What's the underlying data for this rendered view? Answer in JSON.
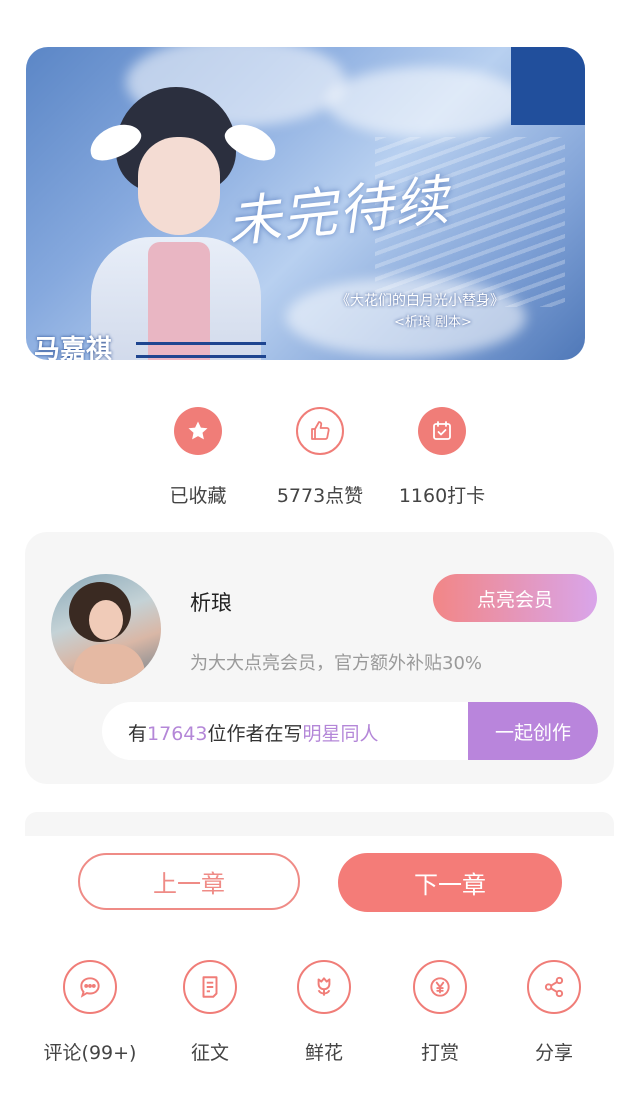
{
  "banner": {
    "title": "未完待续",
    "subtitle": "《大花们的白月光小替身》",
    "author_line": "<析琅 剧本>",
    "star_name": "马嘉祺"
  },
  "stats": [
    {
      "label": "已收藏",
      "icon": "star-icon"
    },
    {
      "label": "5773点赞",
      "icon": "thumbs-up-icon"
    },
    {
      "label": "1160打卡",
      "icon": "calendar-check-icon"
    }
  ],
  "author": {
    "name": "析琅",
    "vip_button": "点亮会员",
    "vip_desc": "为大大点亮会员，官方额外补贴30%"
  },
  "write_prompt": {
    "prefix": "有",
    "count": "17643",
    "middle": "位作者在写",
    "topic": "明星同人",
    "button": "一起创作"
  },
  "chapter_nav": {
    "prev": "上一章",
    "next": "下一章"
  },
  "actions": [
    {
      "label": "评论(99+)",
      "icon": "comment-icon"
    },
    {
      "label": "征文",
      "icon": "contest-icon"
    },
    {
      "label": "鲜花",
      "icon": "flower-icon"
    },
    {
      "label": "打赏",
      "icon": "reward-icon"
    },
    {
      "label": "分享",
      "icon": "share-icon"
    }
  ],
  "colors": {
    "accent": "#f07d78",
    "purple": "#b985dc",
    "card_bg": "#f6f6f6"
  }
}
